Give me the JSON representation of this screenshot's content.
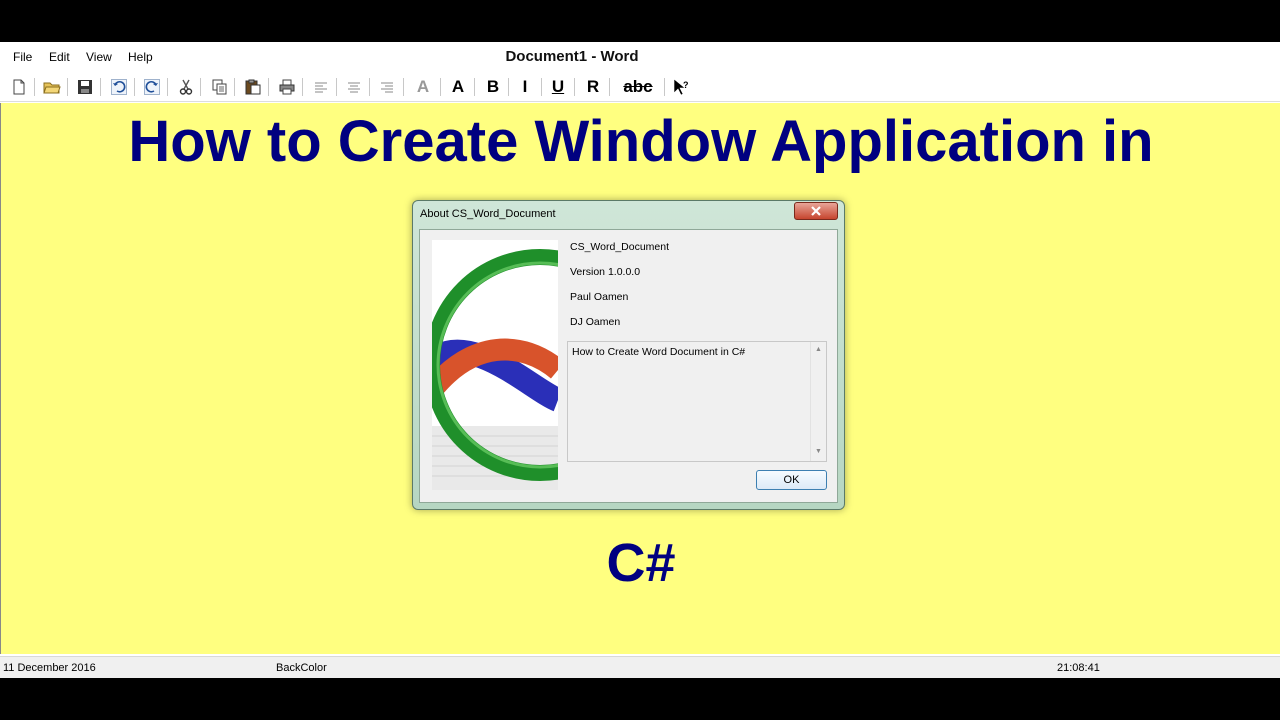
{
  "app": {
    "title": "Document1 - Word",
    "menu": [
      "File",
      "Edit",
      "View",
      "Help"
    ]
  },
  "toolbar": {
    "buttons": [
      {
        "icon": "new-document-icon"
      },
      {
        "icon": "open-folder-icon"
      },
      {
        "icon": "save-icon"
      },
      {
        "icon": "undo-icon"
      },
      {
        "icon": "redo-icon"
      },
      {
        "icon": "cut-icon"
      },
      {
        "icon": "copy-icon"
      },
      {
        "icon": "paste-icon"
      },
      {
        "icon": "print-icon"
      },
      {
        "icon": "align-left-icon"
      },
      {
        "icon": "align-center-icon"
      },
      {
        "icon": "align-right-icon"
      }
    ],
    "font_color_label": "A",
    "font_label": "A",
    "bold_label": "B",
    "italic_label": "I",
    "underline_label": "U",
    "regular_label": "R",
    "strikethrough_label": "abc",
    "help_icon": "help-cursor-icon"
  },
  "document": {
    "heading": "How to Create Window Application in",
    "subheading": "C#",
    "background_color": "#FFFF80",
    "text_color": "#000080"
  },
  "about_dialog": {
    "title": "About CS_Word_Document",
    "product_name": "CS_Word_Document",
    "version": "Version 1.0.0.0",
    "copyright": "Paul Oamen",
    "company": "DJ Oamen",
    "description": "How to Create Word Document in C#",
    "ok_label": "OK"
  },
  "statusbar": {
    "date": "11 December 2016",
    "property": "BackColor",
    "time": "21:08:41"
  }
}
